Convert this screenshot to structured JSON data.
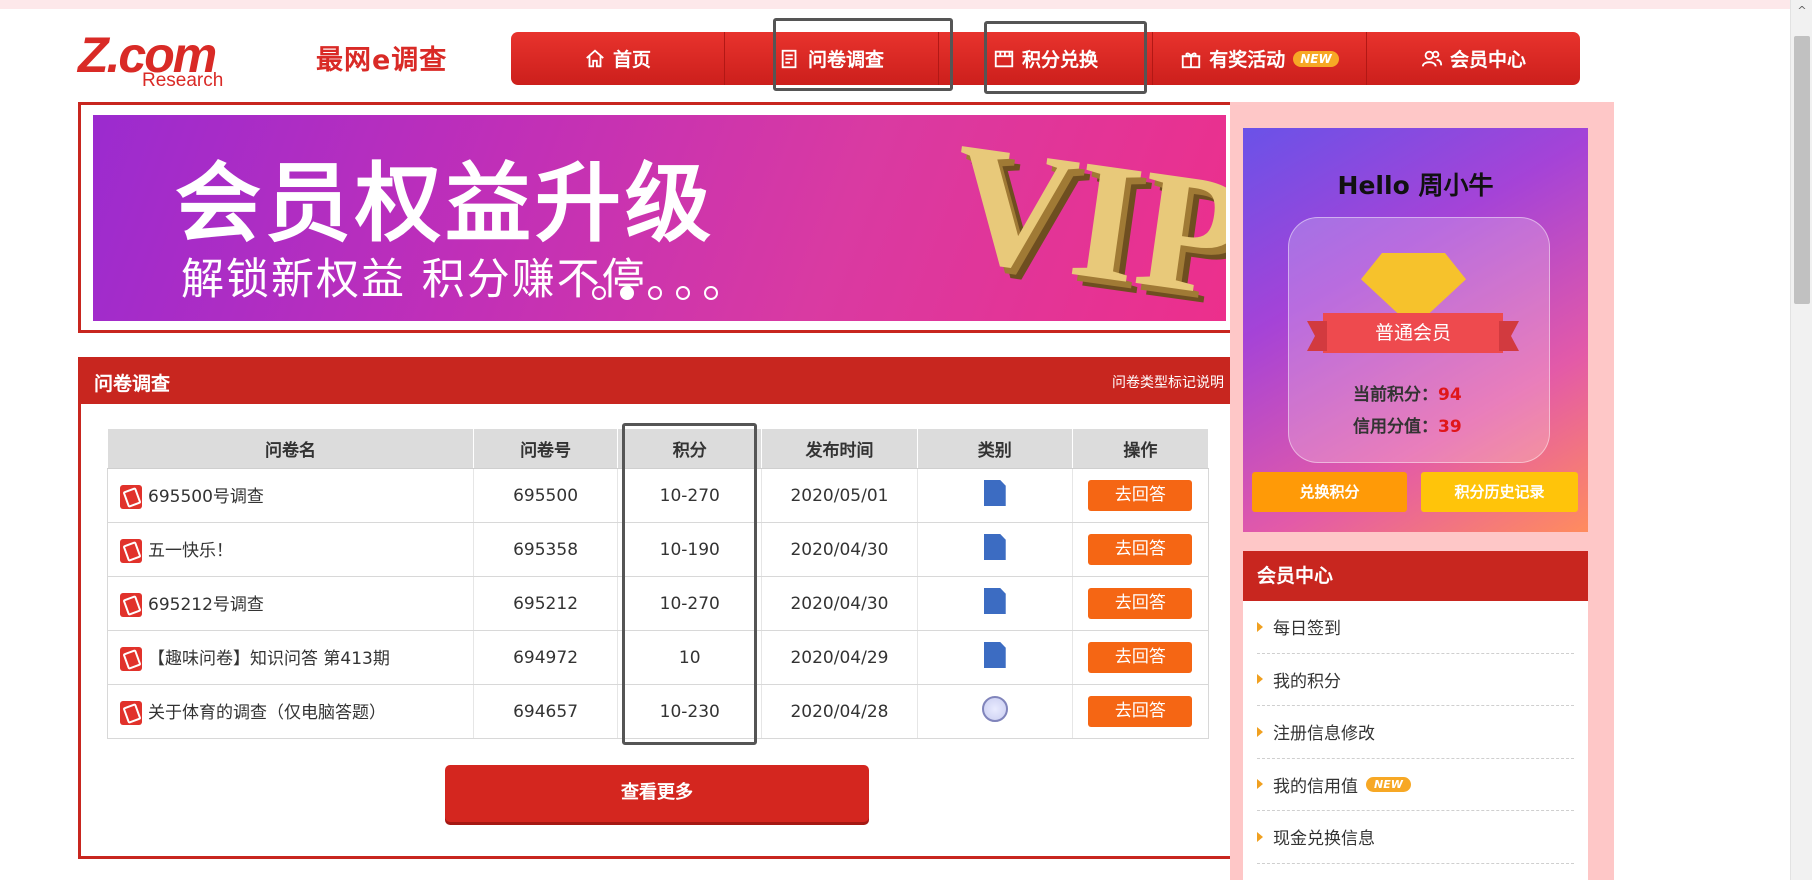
{
  "logo": {
    "brand": "Z.com",
    "sub": "Research",
    "cn": "最网e调查"
  },
  "nav": [
    {
      "label": "首页",
      "icon": "home-icon"
    },
    {
      "label": "问卷调查",
      "icon": "survey-icon"
    },
    {
      "label": "积分兑换",
      "icon": "shop-icon"
    },
    {
      "label": "有奖活动",
      "icon": "gift-icon",
      "badge": "NEW"
    },
    {
      "label": "会员中心",
      "icon": "members-icon"
    }
  ],
  "banner": {
    "title": "会员权益升级",
    "subtitle": "解锁新权益 积分赚不停",
    "vip": "VIP"
  },
  "survey": {
    "title": "问卷调查",
    "legend_link": "问卷类型标记说明",
    "columns": [
      "问卷名",
      "问卷号",
      "积分",
      "发布时间",
      "类别",
      "操作"
    ],
    "rows": [
      {
        "name": "695500号调查",
        "id": "695500",
        "points": "10-270",
        "date": "2020/05/01",
        "type": "doc-icon",
        "action": "去回答"
      },
      {
        "name": "五一快乐！",
        "id": "695358",
        "points": "10-190",
        "date": "2020/04/30",
        "type": "doc-icon",
        "action": "去回答"
      },
      {
        "name": "695212号调查",
        "id": "695212",
        "points": "10-270",
        "date": "2020/04/30",
        "type": "doc-icon",
        "action": "去回答"
      },
      {
        "name": "【趣味问卷】知识问答 第413期",
        "id": "694972",
        "points": "10",
        "date": "2020/04/29",
        "type": "doc-icon",
        "action": "去回答"
      },
      {
        "name": "关于体育的调查（仅电脑答题）",
        "id": "694657",
        "points": "10-230",
        "date": "2020/04/28",
        "type": "globe-icon",
        "action": "去回答"
      }
    ],
    "more_label": "查看更多"
  },
  "profile": {
    "greeting": "Hello 周小牛",
    "level": "普通会员",
    "points_label": "当前积分：",
    "points_value": "94",
    "credit_label": "信用分值：",
    "credit_value": "39",
    "btn_exchange": "兑换积分",
    "btn_history": "积分历史记录"
  },
  "member_center": {
    "title": "会员中心",
    "items": [
      {
        "label": "每日签到"
      },
      {
        "label": "我的积分"
      },
      {
        "label": "注册信息修改"
      },
      {
        "label": "我的信用值",
        "badge": "NEW"
      },
      {
        "label": "现金兑换信息"
      }
    ]
  },
  "colors": {
    "brand_red": "#c8261f",
    "answer_orange": "#f56614",
    "sidebar_pink": "#fec7c7"
  }
}
